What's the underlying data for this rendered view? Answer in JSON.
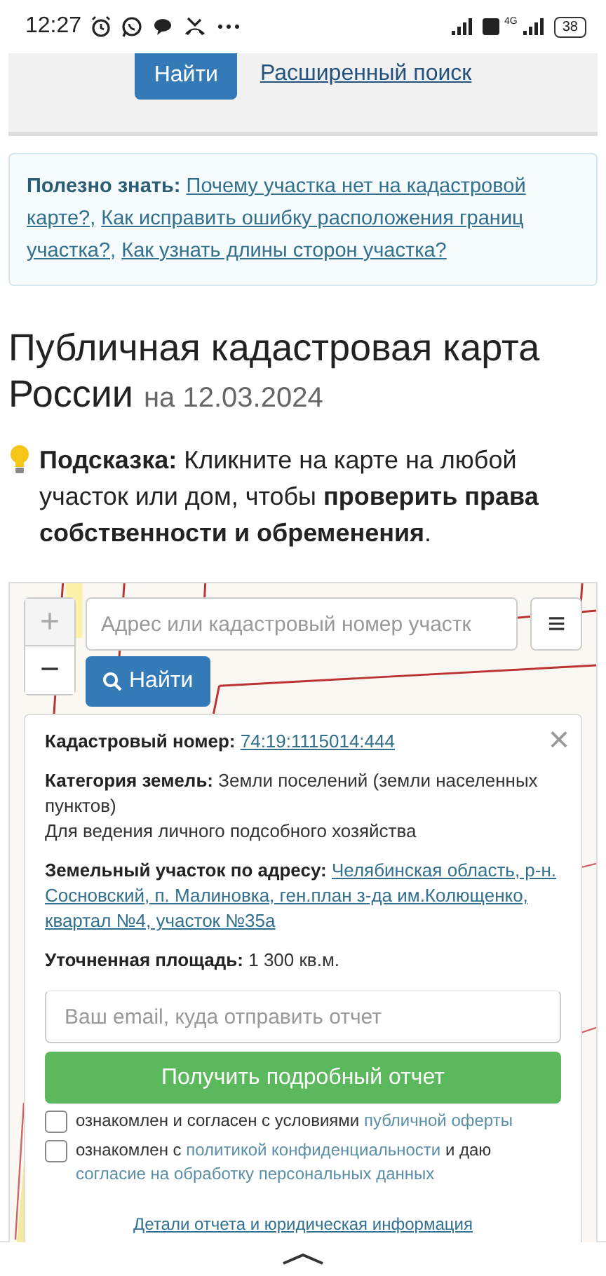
{
  "status_bar": {
    "time": "12:27",
    "network": "4G",
    "battery": "38"
  },
  "search_panel": {
    "button": "Найти",
    "link": "Расширенный поиск"
  },
  "tips": {
    "label": "Полезно знать:",
    "links": [
      "Почему участка нет на кадастровой карте?,",
      "Как исправить ошибку расположения границ участка?,",
      "Как узнать длины сторон участка?"
    ]
  },
  "heading": {
    "title": "Публичная кадастровая карта России",
    "date": "на 12.03.2024"
  },
  "hint": "**Подсказка:** Кликните на карте на любой участок или дом, чтобы **проверить права собственности и обременения**.",
  "map": {
    "zoom_in": "+",
    "zoom_out": "−",
    "search": {
      "placeholder": "Адрес или кадастровый номер участк"
    },
    "menu": "≡",
    "find_button": "Найти",
    "popup": {
      "close": "×",
      "fields": [
        {
          "kind": "link",
          "label": "Кадастровый номер:",
          "value": "74:19:1115014:444"
        },
        {
          "kind": "text",
          "label": "Категория земель:",
          "value": "Земли поселений (земли населенных пунктов)"
        },
        {
          "kind": "plain",
          "value": "Для ведения личного подсобного хозяйства"
        },
        {
          "kind": "link",
          "label": "Земельный участок по адресу:",
          "value": "Челябинская область, р-н. Сосновский, п. Малиновка, ген.план з-да им.Колющенко, квартал №4, участок №35а"
        },
        {
          "kind": "text",
          "label": "Уточненная площадь:",
          "value": "1 300 кв.м."
        }
      ],
      "email": {
        "placeholder": "Ваш email, куда отправить отчет"
      },
      "report_button": "Получить подробный отчет",
      "agreements": [
        {
          "checked": false,
          "parts": [
            {
              "kind": "text",
              "text": "ознакомлен и согласен с условиями"
            },
            {
              "kind": "link",
              "text": "публичной оферты"
            }
          ]
        },
        {
          "checked": false,
          "parts": [
            {
              "kind": "text",
              "text": "ознакомлен с"
            },
            {
              "kind": "link",
              "text": "политикой конфиденциальности"
            },
            {
              "kind": "text",
              "text": "и даю"
            },
            {
              "kind": "link",
              "text": "согласие на обработку персональных данных"
            }
          ]
        }
      ],
      "details_link": "Детали отчета и юридическая информация"
    }
  }
}
